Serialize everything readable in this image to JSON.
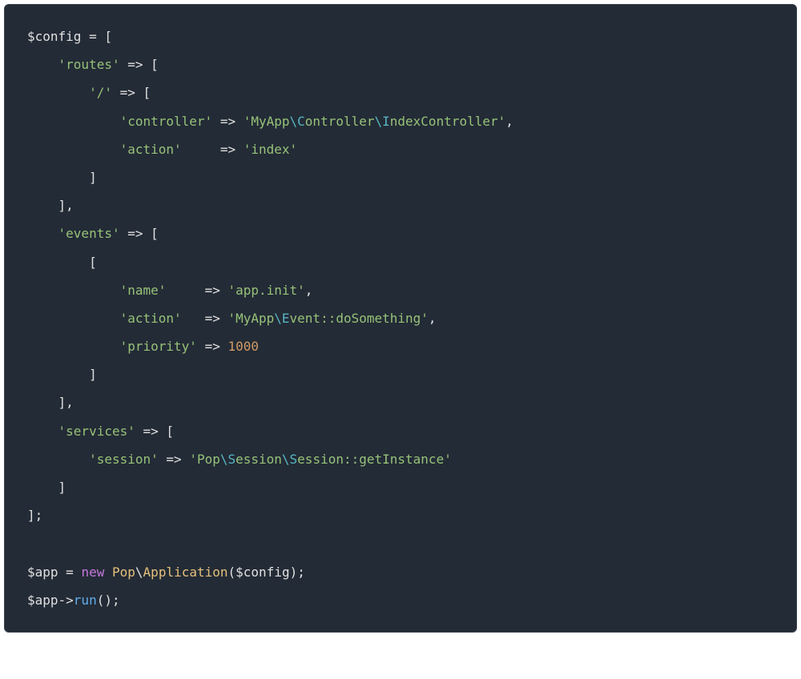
{
  "code": {
    "tokens": [
      [
        {
          "t": "var",
          "v": "$config"
        },
        {
          "t": "punct",
          "v": " "
        },
        {
          "t": "op",
          "v": "="
        },
        {
          "t": "punct",
          "v": " "
        },
        {
          "t": "punct",
          "v": "["
        }
      ],
      [
        {
          "t": "punct",
          "v": "    "
        },
        {
          "t": "string",
          "v": "'routes'"
        },
        {
          "t": "punct",
          "v": " "
        },
        {
          "t": "op",
          "v": "=>"
        },
        {
          "t": "punct",
          "v": " "
        },
        {
          "t": "punct",
          "v": "["
        }
      ],
      [
        {
          "t": "punct",
          "v": "        "
        },
        {
          "t": "string",
          "v": "'/'"
        },
        {
          "t": "punct",
          "v": " "
        },
        {
          "t": "op",
          "v": "=>"
        },
        {
          "t": "punct",
          "v": " "
        },
        {
          "t": "punct",
          "v": "["
        }
      ],
      [
        {
          "t": "punct",
          "v": "            "
        },
        {
          "t": "string",
          "v": "'controller'"
        },
        {
          "t": "punct",
          "v": " "
        },
        {
          "t": "op",
          "v": "=>"
        },
        {
          "t": "punct",
          "v": " "
        },
        {
          "t": "string",
          "v": "'MyApp"
        },
        {
          "t": "escape",
          "v": "\\C"
        },
        {
          "t": "string",
          "v": "ontroller"
        },
        {
          "t": "escape",
          "v": "\\I"
        },
        {
          "t": "string",
          "v": "ndexController'"
        },
        {
          "t": "punct",
          "v": ","
        }
      ],
      [
        {
          "t": "punct",
          "v": "            "
        },
        {
          "t": "string",
          "v": "'action'"
        },
        {
          "t": "punct",
          "v": "     "
        },
        {
          "t": "op",
          "v": "=>"
        },
        {
          "t": "punct",
          "v": " "
        },
        {
          "t": "string",
          "v": "'index'"
        }
      ],
      [
        {
          "t": "punct",
          "v": "        "
        },
        {
          "t": "punct",
          "v": "]"
        }
      ],
      [
        {
          "t": "punct",
          "v": "    "
        },
        {
          "t": "punct",
          "v": "],"
        }
      ],
      [
        {
          "t": "punct",
          "v": "    "
        },
        {
          "t": "string",
          "v": "'events'"
        },
        {
          "t": "punct",
          "v": " "
        },
        {
          "t": "op",
          "v": "=>"
        },
        {
          "t": "punct",
          "v": " "
        },
        {
          "t": "punct",
          "v": "["
        }
      ],
      [
        {
          "t": "punct",
          "v": "        "
        },
        {
          "t": "punct",
          "v": "["
        }
      ],
      [
        {
          "t": "punct",
          "v": "            "
        },
        {
          "t": "string",
          "v": "'name'"
        },
        {
          "t": "punct",
          "v": "     "
        },
        {
          "t": "op",
          "v": "=>"
        },
        {
          "t": "punct",
          "v": " "
        },
        {
          "t": "string",
          "v": "'app.init'"
        },
        {
          "t": "punct",
          "v": ","
        }
      ],
      [
        {
          "t": "punct",
          "v": "            "
        },
        {
          "t": "string",
          "v": "'action'"
        },
        {
          "t": "punct",
          "v": "   "
        },
        {
          "t": "op",
          "v": "=>"
        },
        {
          "t": "punct",
          "v": " "
        },
        {
          "t": "string",
          "v": "'MyApp"
        },
        {
          "t": "escape",
          "v": "\\E"
        },
        {
          "t": "string",
          "v": "vent::doSomething'"
        },
        {
          "t": "punct",
          "v": ","
        }
      ],
      [
        {
          "t": "punct",
          "v": "            "
        },
        {
          "t": "string",
          "v": "'priority'"
        },
        {
          "t": "punct",
          "v": " "
        },
        {
          "t": "op",
          "v": "=>"
        },
        {
          "t": "punct",
          "v": " "
        },
        {
          "t": "number",
          "v": "1000"
        }
      ],
      [
        {
          "t": "punct",
          "v": "        "
        },
        {
          "t": "punct",
          "v": "]"
        }
      ],
      [
        {
          "t": "punct",
          "v": "    "
        },
        {
          "t": "punct",
          "v": "],"
        }
      ],
      [
        {
          "t": "punct",
          "v": "    "
        },
        {
          "t": "string",
          "v": "'services'"
        },
        {
          "t": "punct",
          "v": " "
        },
        {
          "t": "op",
          "v": "=>"
        },
        {
          "t": "punct",
          "v": " "
        },
        {
          "t": "punct",
          "v": "["
        }
      ],
      [
        {
          "t": "punct",
          "v": "        "
        },
        {
          "t": "string",
          "v": "'session'"
        },
        {
          "t": "punct",
          "v": " "
        },
        {
          "t": "op",
          "v": "=>"
        },
        {
          "t": "punct",
          "v": " "
        },
        {
          "t": "string",
          "v": "'Pop"
        },
        {
          "t": "escape",
          "v": "\\S"
        },
        {
          "t": "string",
          "v": "ession"
        },
        {
          "t": "escape",
          "v": "\\S"
        },
        {
          "t": "string",
          "v": "ession::getInstance'"
        }
      ],
      [
        {
          "t": "punct",
          "v": "    "
        },
        {
          "t": "punct",
          "v": "]"
        }
      ],
      [
        {
          "t": "punct",
          "v": "];"
        }
      ],
      [],
      [
        {
          "t": "var",
          "v": "$app"
        },
        {
          "t": "punct",
          "v": " "
        },
        {
          "t": "op",
          "v": "="
        },
        {
          "t": "punct",
          "v": " "
        },
        {
          "t": "keyword",
          "v": "new"
        },
        {
          "t": "punct",
          "v": " "
        },
        {
          "t": "class",
          "v": "Pop"
        },
        {
          "t": "punct",
          "v": "\\"
        },
        {
          "t": "class",
          "v": "Application"
        },
        {
          "t": "punct",
          "v": "("
        },
        {
          "t": "var",
          "v": "$config"
        },
        {
          "t": "punct",
          "v": ");"
        }
      ],
      [
        {
          "t": "var",
          "v": "$app"
        },
        {
          "t": "op",
          "v": "->"
        },
        {
          "t": "func",
          "v": "run"
        },
        {
          "t": "punct",
          "v": "();"
        }
      ]
    ]
  },
  "colors": {
    "background": "#232b36",
    "string": "#97c279",
    "number": "#d19a66",
    "keyword": "#c678dd",
    "class": "#e5c07b",
    "func": "#61afef",
    "escape": "#56b6c2",
    "default": "#e0e0e0"
  }
}
